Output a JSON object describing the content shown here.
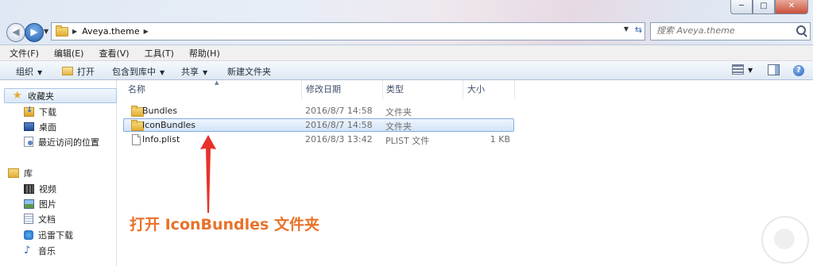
{
  "window": {
    "controls": {
      "minimize": "─",
      "maximize": "□",
      "close": "✕"
    }
  },
  "nav": {
    "back": "◀",
    "forward": "▶"
  },
  "address": {
    "crumb": "Aveya.theme",
    "sep1": "▶",
    "sep2": "▶"
  },
  "search": {
    "placeholder": "搜索 Aveya.theme"
  },
  "menubar": {
    "items": [
      "文件(F)",
      "编辑(E)",
      "查看(V)",
      "工具(T)",
      "帮助(H)"
    ]
  },
  "toolbar": {
    "organize": "组织",
    "open": "打开",
    "include_in_library": "包含到库中",
    "share": "共享",
    "new_folder": "新建文件夹",
    "help": "?"
  },
  "sidebar": {
    "favorites": {
      "label": "收藏夹",
      "items": [
        "下载",
        "桌面",
        "最近访问的位置"
      ]
    },
    "libraries": {
      "label": "库",
      "items": [
        "视频",
        "图片",
        "文档",
        "迅雷下载",
        "音乐"
      ]
    }
  },
  "columns": {
    "name": "名称",
    "modified": "修改日期",
    "type": "类型",
    "size": "大小"
  },
  "files": [
    {
      "name": "Bundles",
      "modified": "2016/8/7 14:58",
      "type": "文件夹",
      "size": ""
    },
    {
      "name": "IconBundles",
      "modified": "2016/8/7 14:58",
      "type": "文件夹",
      "size": ""
    },
    {
      "name": "Info.plist",
      "modified": "2016/8/3 13:42",
      "type": "PLIST 文件",
      "size": "1 KB"
    }
  ],
  "annotation": {
    "text": "打开 IconBundles 文件夹",
    "color": "#e8722a"
  },
  "colors": {
    "selection": "#d2e4f8",
    "accent": "#2b65b5"
  }
}
